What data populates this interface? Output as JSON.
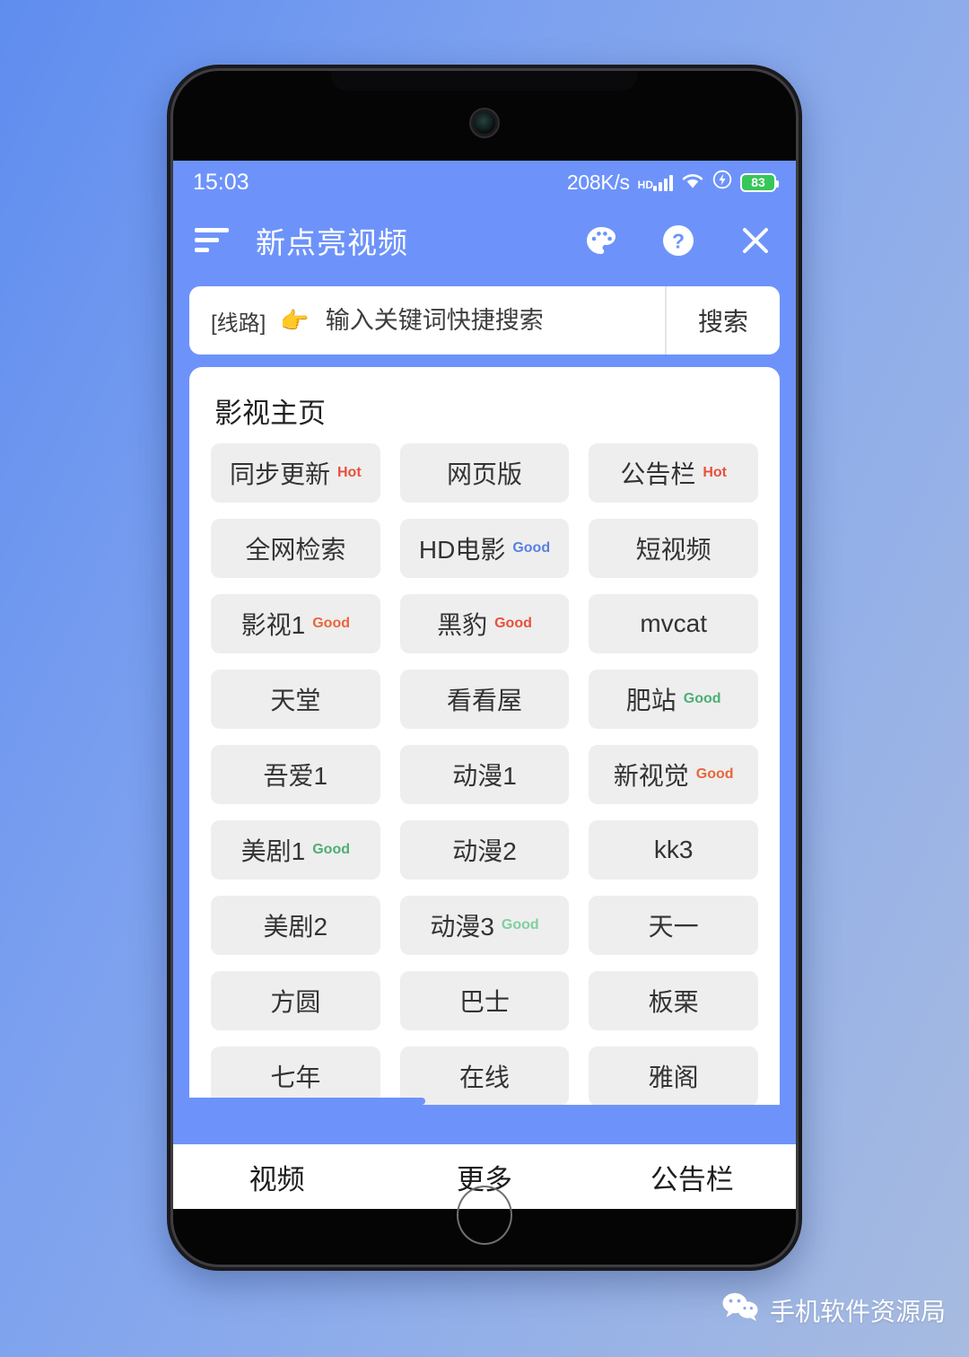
{
  "status_bar": {
    "time": "15:03",
    "network_speed": "208K/s",
    "hd_tag": "HD",
    "battery_level": "83",
    "icons": [
      "signal-icon",
      "wifi-icon",
      "charging-bolt-icon",
      "battery-icon"
    ]
  },
  "app_bar": {
    "title": "新点亮视频",
    "menu_icon": "list-lines-icon",
    "palette_icon": "palette-icon",
    "help_icon": "help-circle-icon",
    "close_icon": "close-x-icon"
  },
  "search": {
    "route_label": "[线路]",
    "hand_emoji": "👉",
    "placeholder": "输入关键词快捷搜索",
    "value": "",
    "button_label": "搜索"
  },
  "content": {
    "section_title": "影视主页",
    "tiles": [
      {
        "label": "同步更新",
        "badge": "Hot",
        "badge_color": "#e8503a"
      },
      {
        "label": "网页版",
        "badge": "",
        "badge_color": ""
      },
      {
        "label": "公告栏",
        "badge": "Hot",
        "badge_color": "#e8503a"
      },
      {
        "label": "全网检索",
        "badge": "",
        "badge_color": ""
      },
      {
        "label": "HD电影",
        "badge": "Good",
        "badge_color": "#5a7fe0"
      },
      {
        "label": "短视频",
        "badge": "",
        "badge_color": ""
      },
      {
        "label": "影视1",
        "badge": "Good",
        "badge_color": "#e8663a"
      },
      {
        "label": "黑豹",
        "badge": "Good",
        "badge_color": "#e8503a"
      },
      {
        "label": "mvcat",
        "badge": "",
        "badge_color": ""
      },
      {
        "label": "天堂",
        "badge": "",
        "badge_color": ""
      },
      {
        "label": "看看屋",
        "badge": "",
        "badge_color": ""
      },
      {
        "label": "肥站",
        "badge": "Good",
        "badge_color": "#4caf72"
      },
      {
        "label": "吾爱1",
        "badge": "",
        "badge_color": ""
      },
      {
        "label": "动漫1",
        "badge": "",
        "badge_color": ""
      },
      {
        "label": "新视觉",
        "badge": "Good",
        "badge_color": "#e8663a"
      },
      {
        "label": "美剧1",
        "badge": "Good",
        "badge_color": "#4caf72"
      },
      {
        "label": "动漫2",
        "badge": "",
        "badge_color": ""
      },
      {
        "label": "kk3",
        "badge": "",
        "badge_color": ""
      },
      {
        "label": "美剧2",
        "badge": "",
        "badge_color": ""
      },
      {
        "label": "动漫3",
        "badge": "Good",
        "badge_color": "#7fcfa0"
      },
      {
        "label": "天一",
        "badge": "",
        "badge_color": ""
      },
      {
        "label": "方圆",
        "badge": "",
        "badge_color": ""
      },
      {
        "label": "巴士",
        "badge": "",
        "badge_color": ""
      },
      {
        "label": "板栗",
        "badge": "",
        "badge_color": ""
      },
      {
        "label": "七年",
        "badge": "",
        "badge_color": ""
      },
      {
        "label": "在线",
        "badge": "",
        "badge_color": ""
      },
      {
        "label": "雅阁",
        "badge": "",
        "badge_color": ""
      }
    ],
    "progress_percent": "40"
  },
  "tab_bar": {
    "tabs": [
      {
        "label": "视频"
      },
      {
        "label": "更多"
      },
      {
        "label": "公告栏"
      }
    ]
  },
  "watermark": {
    "icon": "wechat-icon",
    "text": "手机软件资源局"
  },
  "colors": {
    "app_blue": "#6d93fb",
    "tile_gray": "#eeeeee",
    "battery_green": "#35c759"
  }
}
